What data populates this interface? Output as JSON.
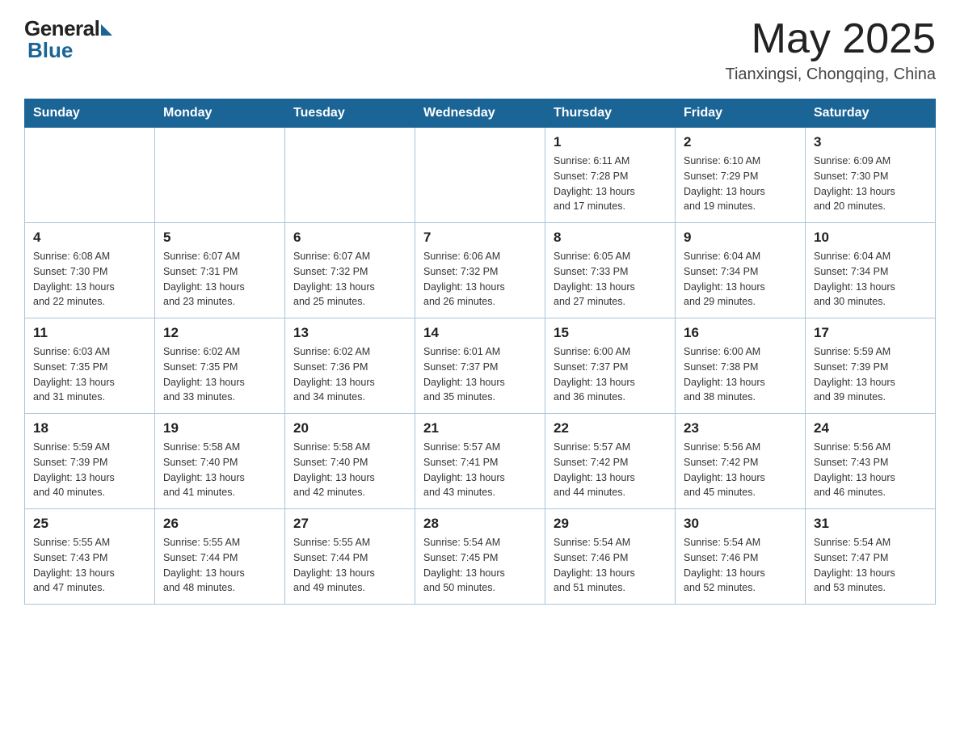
{
  "header": {
    "logo_general": "General",
    "logo_blue": "Blue",
    "title_month": "May 2025",
    "title_location": "Tianxingsi, Chongqing, China"
  },
  "weekdays": [
    "Sunday",
    "Monday",
    "Tuesday",
    "Wednesday",
    "Thursday",
    "Friday",
    "Saturday"
  ],
  "weeks": [
    [
      {
        "day": "",
        "info": ""
      },
      {
        "day": "",
        "info": ""
      },
      {
        "day": "",
        "info": ""
      },
      {
        "day": "",
        "info": ""
      },
      {
        "day": "1",
        "info": "Sunrise: 6:11 AM\nSunset: 7:28 PM\nDaylight: 13 hours\nand 17 minutes."
      },
      {
        "day": "2",
        "info": "Sunrise: 6:10 AM\nSunset: 7:29 PM\nDaylight: 13 hours\nand 19 minutes."
      },
      {
        "day": "3",
        "info": "Sunrise: 6:09 AM\nSunset: 7:30 PM\nDaylight: 13 hours\nand 20 minutes."
      }
    ],
    [
      {
        "day": "4",
        "info": "Sunrise: 6:08 AM\nSunset: 7:30 PM\nDaylight: 13 hours\nand 22 minutes."
      },
      {
        "day": "5",
        "info": "Sunrise: 6:07 AM\nSunset: 7:31 PM\nDaylight: 13 hours\nand 23 minutes."
      },
      {
        "day": "6",
        "info": "Sunrise: 6:07 AM\nSunset: 7:32 PM\nDaylight: 13 hours\nand 25 minutes."
      },
      {
        "day": "7",
        "info": "Sunrise: 6:06 AM\nSunset: 7:32 PM\nDaylight: 13 hours\nand 26 minutes."
      },
      {
        "day": "8",
        "info": "Sunrise: 6:05 AM\nSunset: 7:33 PM\nDaylight: 13 hours\nand 27 minutes."
      },
      {
        "day": "9",
        "info": "Sunrise: 6:04 AM\nSunset: 7:34 PM\nDaylight: 13 hours\nand 29 minutes."
      },
      {
        "day": "10",
        "info": "Sunrise: 6:04 AM\nSunset: 7:34 PM\nDaylight: 13 hours\nand 30 minutes."
      }
    ],
    [
      {
        "day": "11",
        "info": "Sunrise: 6:03 AM\nSunset: 7:35 PM\nDaylight: 13 hours\nand 31 minutes."
      },
      {
        "day": "12",
        "info": "Sunrise: 6:02 AM\nSunset: 7:35 PM\nDaylight: 13 hours\nand 33 minutes."
      },
      {
        "day": "13",
        "info": "Sunrise: 6:02 AM\nSunset: 7:36 PM\nDaylight: 13 hours\nand 34 minutes."
      },
      {
        "day": "14",
        "info": "Sunrise: 6:01 AM\nSunset: 7:37 PM\nDaylight: 13 hours\nand 35 minutes."
      },
      {
        "day": "15",
        "info": "Sunrise: 6:00 AM\nSunset: 7:37 PM\nDaylight: 13 hours\nand 36 minutes."
      },
      {
        "day": "16",
        "info": "Sunrise: 6:00 AM\nSunset: 7:38 PM\nDaylight: 13 hours\nand 38 minutes."
      },
      {
        "day": "17",
        "info": "Sunrise: 5:59 AM\nSunset: 7:39 PM\nDaylight: 13 hours\nand 39 minutes."
      }
    ],
    [
      {
        "day": "18",
        "info": "Sunrise: 5:59 AM\nSunset: 7:39 PM\nDaylight: 13 hours\nand 40 minutes."
      },
      {
        "day": "19",
        "info": "Sunrise: 5:58 AM\nSunset: 7:40 PM\nDaylight: 13 hours\nand 41 minutes."
      },
      {
        "day": "20",
        "info": "Sunrise: 5:58 AM\nSunset: 7:40 PM\nDaylight: 13 hours\nand 42 minutes."
      },
      {
        "day": "21",
        "info": "Sunrise: 5:57 AM\nSunset: 7:41 PM\nDaylight: 13 hours\nand 43 minutes."
      },
      {
        "day": "22",
        "info": "Sunrise: 5:57 AM\nSunset: 7:42 PM\nDaylight: 13 hours\nand 44 minutes."
      },
      {
        "day": "23",
        "info": "Sunrise: 5:56 AM\nSunset: 7:42 PM\nDaylight: 13 hours\nand 45 minutes."
      },
      {
        "day": "24",
        "info": "Sunrise: 5:56 AM\nSunset: 7:43 PM\nDaylight: 13 hours\nand 46 minutes."
      }
    ],
    [
      {
        "day": "25",
        "info": "Sunrise: 5:55 AM\nSunset: 7:43 PM\nDaylight: 13 hours\nand 47 minutes."
      },
      {
        "day": "26",
        "info": "Sunrise: 5:55 AM\nSunset: 7:44 PM\nDaylight: 13 hours\nand 48 minutes."
      },
      {
        "day": "27",
        "info": "Sunrise: 5:55 AM\nSunset: 7:44 PM\nDaylight: 13 hours\nand 49 minutes."
      },
      {
        "day": "28",
        "info": "Sunrise: 5:54 AM\nSunset: 7:45 PM\nDaylight: 13 hours\nand 50 minutes."
      },
      {
        "day": "29",
        "info": "Sunrise: 5:54 AM\nSunset: 7:46 PM\nDaylight: 13 hours\nand 51 minutes."
      },
      {
        "day": "30",
        "info": "Sunrise: 5:54 AM\nSunset: 7:46 PM\nDaylight: 13 hours\nand 52 minutes."
      },
      {
        "day": "31",
        "info": "Sunrise: 5:54 AM\nSunset: 7:47 PM\nDaylight: 13 hours\nand 53 minutes."
      }
    ]
  ]
}
